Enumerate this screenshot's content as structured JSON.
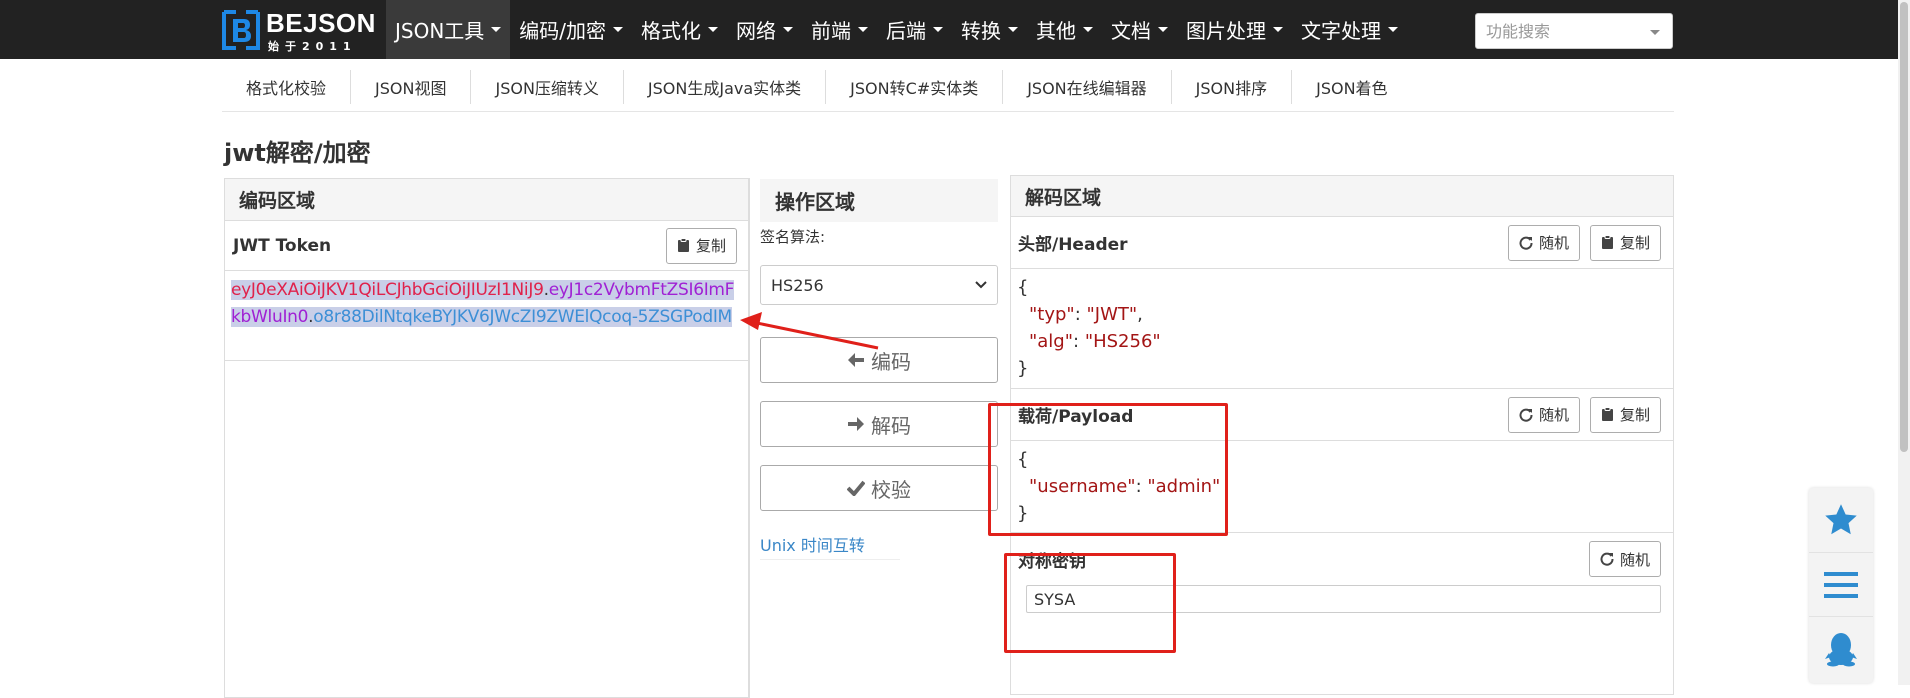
{
  "navbar": {
    "logo_name": "BEJSON",
    "logo_sub": "始于2011",
    "menu": [
      {
        "label": "JSON工具"
      },
      {
        "label": "编码/加密"
      },
      {
        "label": "格式化"
      },
      {
        "label": "网络"
      },
      {
        "label": "前端"
      },
      {
        "label": "后端"
      },
      {
        "label": "转换"
      },
      {
        "label": "其他"
      },
      {
        "label": "文档"
      },
      {
        "label": "图片处理"
      },
      {
        "label": "文字处理"
      }
    ],
    "search_placeholder": "功能搜索"
  },
  "subnav": [
    {
      "label": "格式化校验"
    },
    {
      "label": "JSON视图"
    },
    {
      "label": "JSON压缩转义"
    },
    {
      "label": "JSON生成Java实体类"
    },
    {
      "label": "JSON转C#实体类"
    },
    {
      "label": "JSON在线编辑器"
    },
    {
      "label": "JSON排序"
    },
    {
      "label": "JSON着色"
    }
  ],
  "page_title": "jwt解密/加密",
  "encode_panel": {
    "title": "编码区域",
    "token_label": "JWT Token",
    "copy_label": "复制",
    "token": {
      "header": "eyJ0eXAiOiJKV1QiLCJhbGciOiJIUzI1NiJ9",
      "payload": "eyJ1c2VybmFtZSI6ImFkbWluIn0",
      "signature": "o8r88DilNtqkeBYJKV6JWcZI9ZWElQcoq-5ZSGPodIM",
      "dot": "."
    }
  },
  "operation_panel": {
    "title": "操作区域",
    "sign_label": "签名算法:",
    "algorithm": "HS256",
    "encode_label": "编码",
    "decode_label": "解码",
    "verify_label": "校验",
    "unix_link": "Unix 时间互转"
  },
  "decode_panel": {
    "title": "解码区域",
    "random_label": "随机",
    "copy_label": "复制",
    "header_section": {
      "title": "头部/Header",
      "open": "{",
      "close": "}",
      "fields": [
        {
          "key": "\"typ\"",
          "value": "\"JWT\"",
          "sep": ": ",
          "comma": ","
        },
        {
          "key": "\"alg\"",
          "value": "\"HS256\"",
          "sep": ": ",
          "comma": ""
        }
      ]
    },
    "payload_section": {
      "title": "载荷/Payload",
      "open": "{",
      "close": "}",
      "fields": [
        {
          "key": "\"username\"",
          "value": "\"admin\"",
          "sep": ": ",
          "comma": ""
        }
      ]
    },
    "secret_section": {
      "title": "对称密钥",
      "value": "SYSA"
    }
  },
  "colors": {
    "navbar_bg": "#222222",
    "logo_blue": "#1e88e5",
    "annotation_red": "#e0201a",
    "token_header": "#e0224b",
    "token_payload": "#a021d4",
    "token_signature": "#3d8fd6",
    "json_string": "#a31515",
    "float_icon": "#2f8ccf"
  },
  "icons": {
    "copy": "clipboard-icon",
    "random": "refresh-icon",
    "encode": "arrow-left-icon",
    "decode": "arrow-right-icon",
    "verify": "checkmark-icon",
    "float": [
      "star-icon",
      "menu-icon",
      "qq-penguin-icon"
    ]
  }
}
